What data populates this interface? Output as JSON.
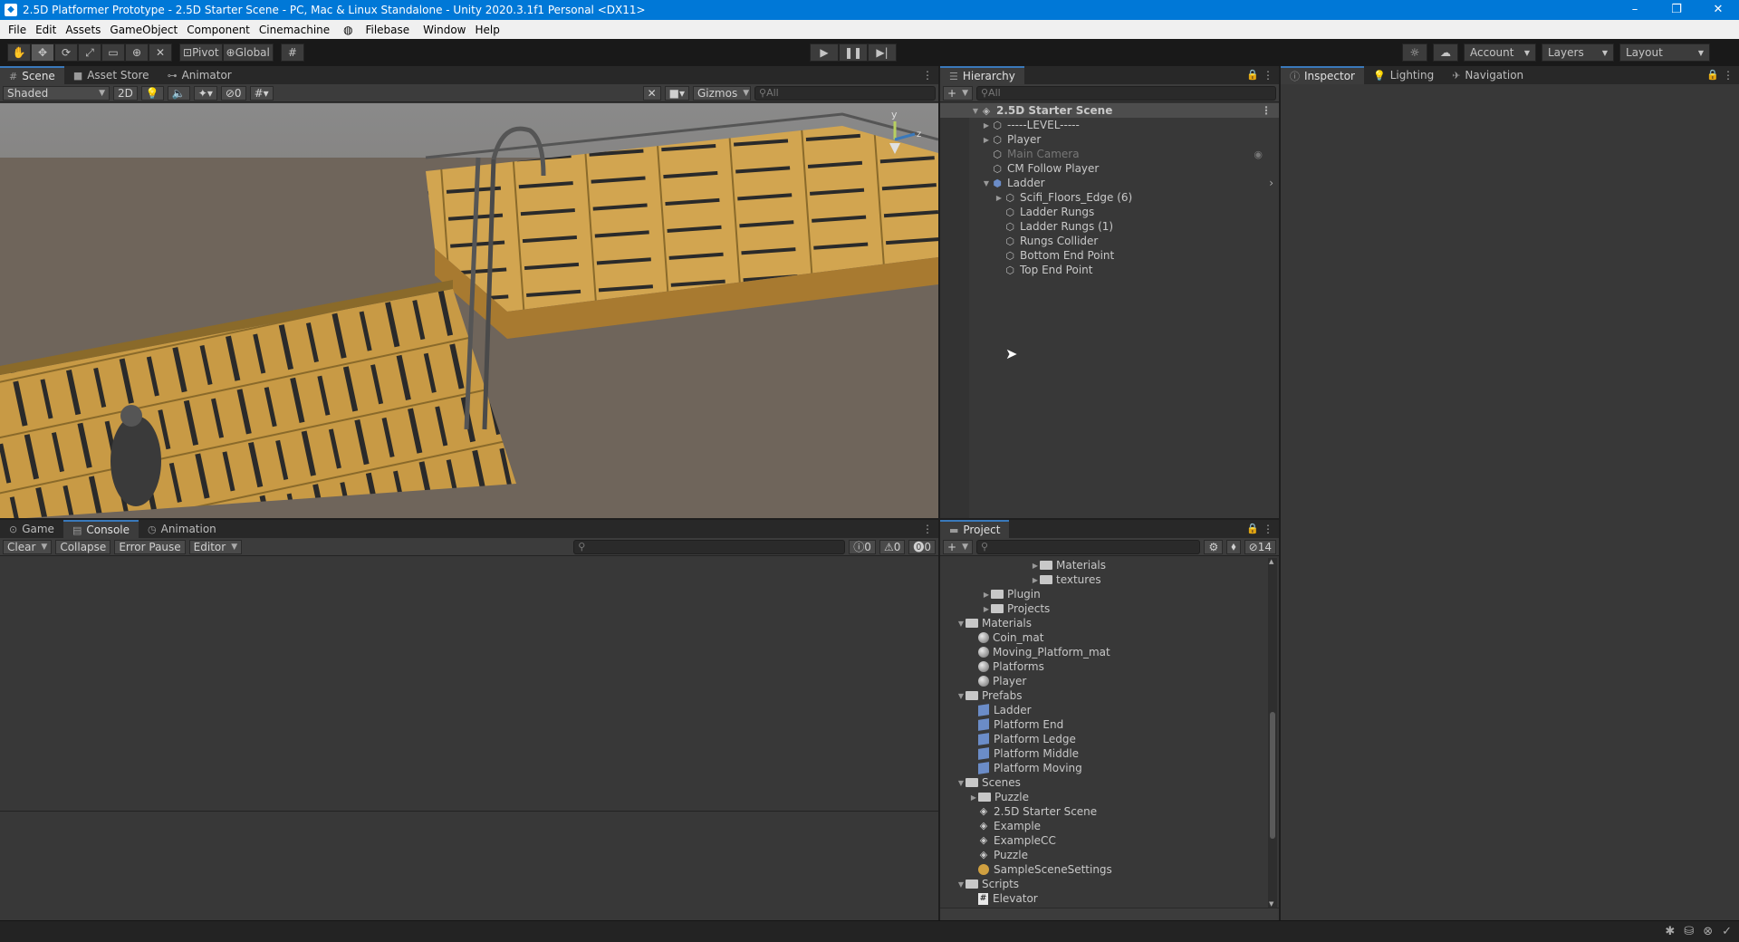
{
  "window": {
    "title": "2.5D Platformer Prototype - 2.5D Starter Scene - PC, Mac & Linux Standalone - Unity 2020.3.1f1 Personal <DX11>",
    "minimize": "–",
    "maximize": "❐",
    "close": "✕"
  },
  "menu": [
    "File",
    "Edit",
    "Assets",
    "GameObject",
    "Component",
    "Cinemachine",
    "Filebase",
    "Window",
    "Help"
  ],
  "toolbar": {
    "pivot": "Pivot",
    "global": "Global",
    "account": "Account",
    "layers": "Layers",
    "layout": "Layout"
  },
  "scene_panel": {
    "tabs": [
      "Scene",
      "Asset Store",
      "Animator"
    ],
    "shading_mode": "Shaded",
    "mode_2d": "2D",
    "hidden_count": "0",
    "gizmos": "Gizmos",
    "search_placeholder": "All"
  },
  "hierarchy": {
    "tab": "Hierarchy",
    "search_placeholder": "All",
    "scene_name": "2.5D Starter Scene",
    "items": [
      {
        "label": "-----LEVEL-----",
        "depth": 1,
        "expandable": true,
        "dim": false
      },
      {
        "label": "Player",
        "depth": 1,
        "expandable": true,
        "dim": false
      },
      {
        "label": "Main Camera",
        "depth": 1,
        "expandable": false,
        "dim": true
      },
      {
        "label": "CM Follow Player",
        "depth": 1,
        "expandable": false,
        "dim": false
      },
      {
        "label": "Ladder",
        "depth": 1,
        "expandable": true,
        "expanded": true,
        "dim": false
      },
      {
        "label": "Scifi_Floors_Edge (6)",
        "depth": 2,
        "expandable": true,
        "dim": false
      },
      {
        "label": "Ladder Rungs",
        "depth": 2,
        "expandable": false,
        "dim": false
      },
      {
        "label": "Ladder Rungs (1)",
        "depth": 2,
        "expandable": false,
        "dim": false
      },
      {
        "label": "Rungs Collider",
        "depth": 2,
        "expandable": false,
        "dim": false
      },
      {
        "label": "Bottom End Point",
        "depth": 2,
        "expandable": false,
        "dim": false
      },
      {
        "label": "Top End Point",
        "depth": 2,
        "expandable": false,
        "dim": false
      }
    ]
  },
  "inspector": {
    "tabs": [
      "Inspector",
      "Lighting",
      "Navigation"
    ]
  },
  "console": {
    "tabs": [
      "Game",
      "Console",
      "Animation"
    ],
    "clear": "Clear",
    "collapse": "Collapse",
    "error_pause": "Error Pause",
    "editor": "Editor",
    "log_count": "0",
    "warning_count": "0",
    "error_count": "0"
  },
  "project": {
    "tab": "Project",
    "hidden_count": "14",
    "items": [
      {
        "label": "Materials",
        "depth": 4,
        "type": "folder",
        "arrow": "▶"
      },
      {
        "label": "textures",
        "depth": 4,
        "type": "folder",
        "arrow": "▶"
      },
      {
        "label": "Plugin",
        "depth": 2,
        "type": "folder",
        "arrow": "▶"
      },
      {
        "label": "Projects",
        "depth": 2,
        "type": "folder",
        "arrow": "▶"
      },
      {
        "label": "Materials",
        "depth": 1,
        "type": "folder",
        "arrow": "▼"
      },
      {
        "label": "Coin_mat",
        "depth": 2,
        "type": "material",
        "arrow": ""
      },
      {
        "label": "Moving_Platform_mat",
        "depth": 2,
        "type": "material",
        "arrow": ""
      },
      {
        "label": "Platforms",
        "depth": 2,
        "type": "material",
        "arrow": ""
      },
      {
        "label": "Player",
        "depth": 2,
        "type": "material",
        "arrow": ""
      },
      {
        "label": "Prefabs",
        "depth": 1,
        "type": "folder",
        "arrow": "▼"
      },
      {
        "label": "Ladder",
        "depth": 2,
        "type": "prefab",
        "arrow": ""
      },
      {
        "label": "Platform End",
        "depth": 2,
        "type": "prefab",
        "arrow": ""
      },
      {
        "label": "Platform Ledge",
        "depth": 2,
        "type": "prefab",
        "arrow": ""
      },
      {
        "label": "Platform Middle",
        "depth": 2,
        "type": "prefab",
        "arrow": ""
      },
      {
        "label": "Platform Moving",
        "depth": 2,
        "type": "prefab",
        "arrow": ""
      },
      {
        "label": "Scenes",
        "depth": 1,
        "type": "folder",
        "arrow": "▼"
      },
      {
        "label": "Puzzle",
        "depth": 2,
        "type": "folder",
        "arrow": "▶"
      },
      {
        "label": "2.5D Starter Scene",
        "depth": 2,
        "type": "scene",
        "arrow": ""
      },
      {
        "label": "Example",
        "depth": 2,
        "type": "scene",
        "arrow": ""
      },
      {
        "label": "ExampleCC",
        "depth": 2,
        "type": "scene",
        "arrow": ""
      },
      {
        "label": "Puzzle",
        "depth": 2,
        "type": "scene",
        "arrow": ""
      },
      {
        "label": "SampleSceneSettings",
        "depth": 2,
        "type": "settings",
        "arrow": ""
      },
      {
        "label": "Scripts",
        "depth": 1,
        "type": "folder",
        "arrow": "▼"
      },
      {
        "label": "Elevator",
        "depth": 2,
        "type": "script",
        "arrow": ""
      }
    ]
  },
  "colors": {
    "accent": "#3a79bb",
    "titlebar": "#0078d7",
    "panel": "#383838"
  }
}
